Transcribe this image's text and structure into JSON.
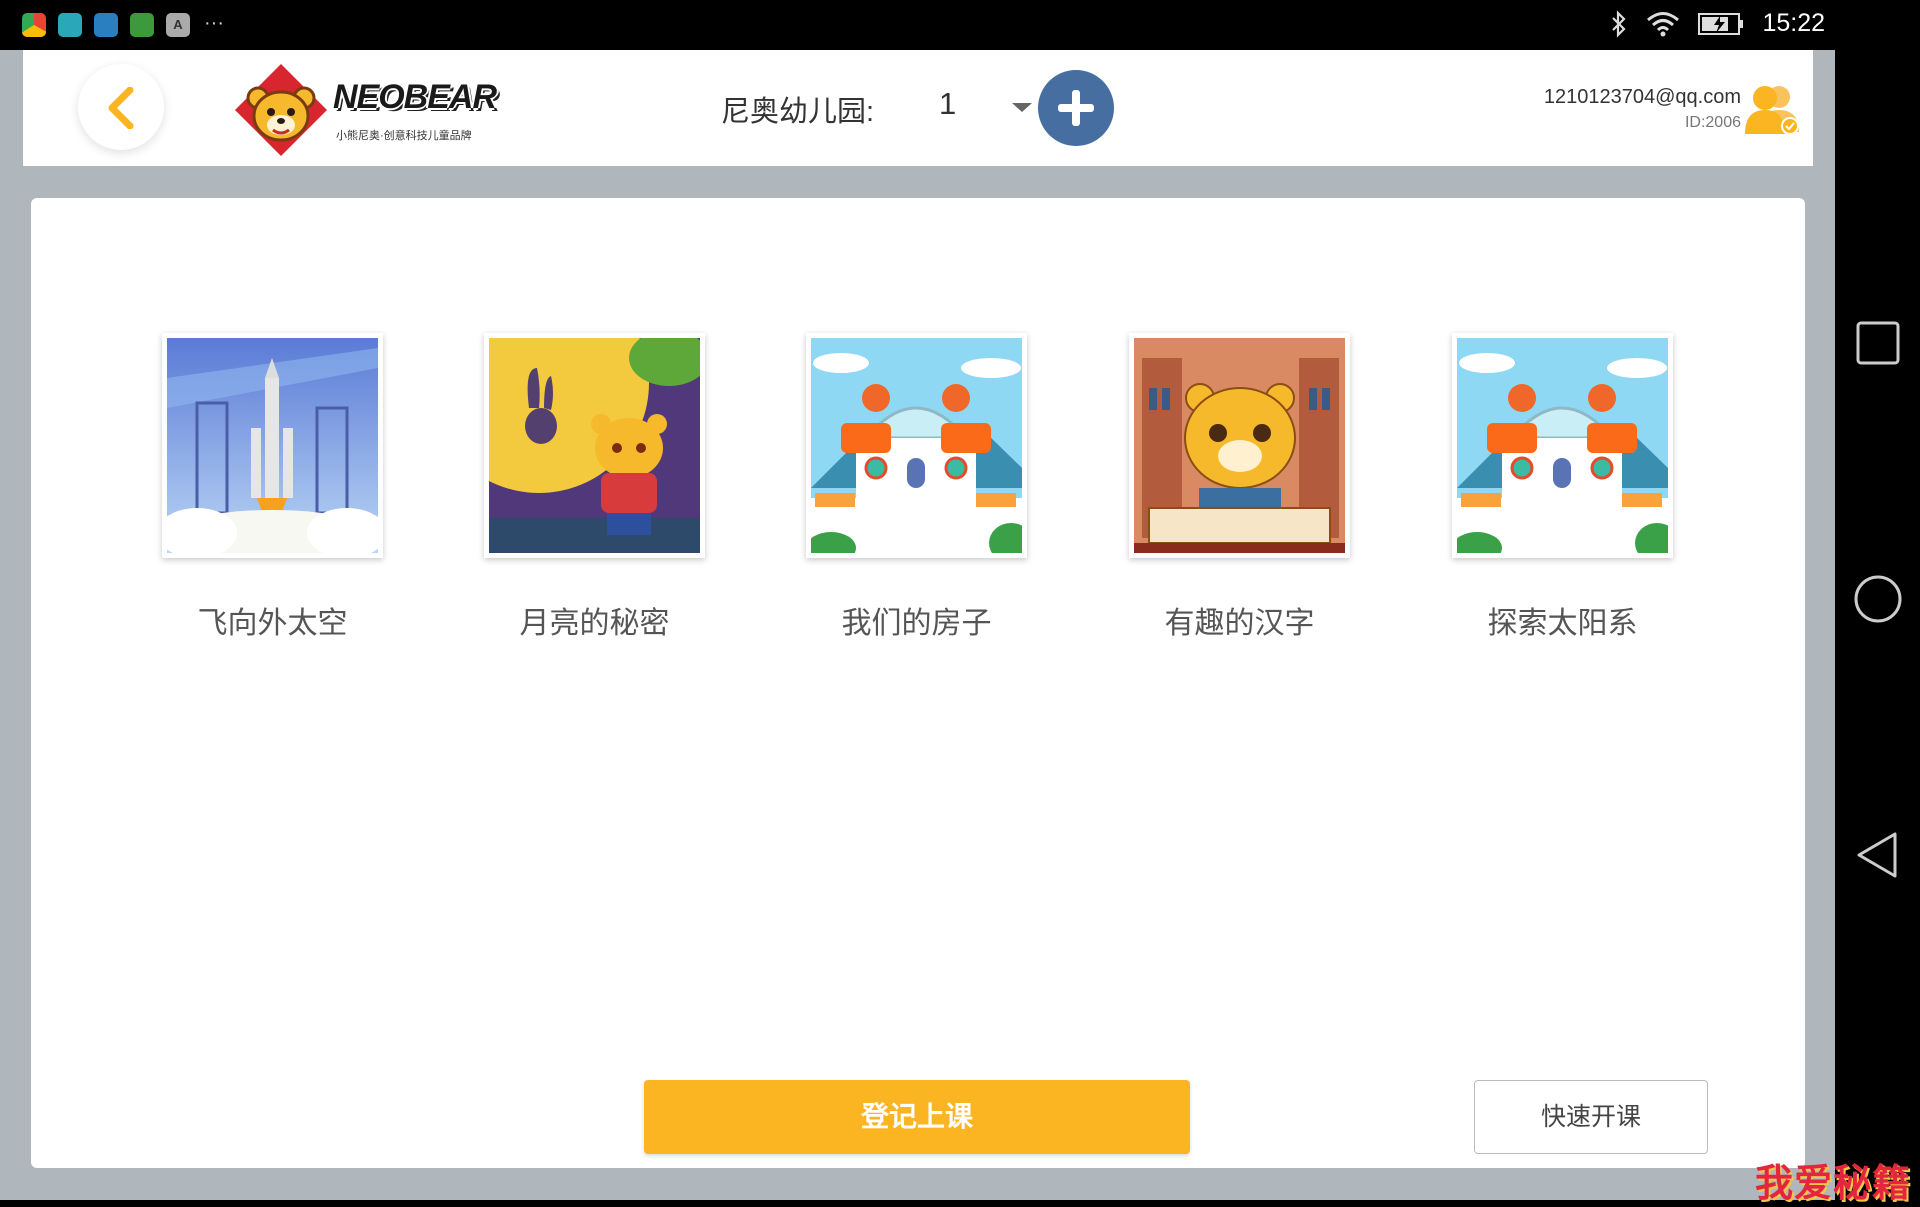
{
  "status_bar": {
    "time": "15:22",
    "app_icons": [
      "chrome-icon",
      "android-icon",
      "shield-app-icon",
      "frog-app-icon",
      "keyboard-app-icon"
    ],
    "keyboard_icon_letter": "A",
    "more": "···"
  },
  "header": {
    "brand": "NEOBEAR",
    "tagline": "小熊尼奥·创意科技儿童品牌",
    "school_label": "尼奥幼儿园:",
    "school_value": "1",
    "user_email": "1210123704@qq.com",
    "user_id": "ID:2006"
  },
  "courses": [
    {
      "title": "飞向外太空"
    },
    {
      "title": "月亮的秘密"
    },
    {
      "title": "我们的房子"
    },
    {
      "title": "有趣的汉字"
    },
    {
      "title": "探索太阳系"
    }
  ],
  "actions": {
    "register_label": "登记上课",
    "quick_start_label": "快速开课"
  },
  "watermark": "我爱秘籍",
  "colors": {
    "accent": "#fbb523",
    "add_button": "#466ea1",
    "background": "#afb7bd"
  }
}
